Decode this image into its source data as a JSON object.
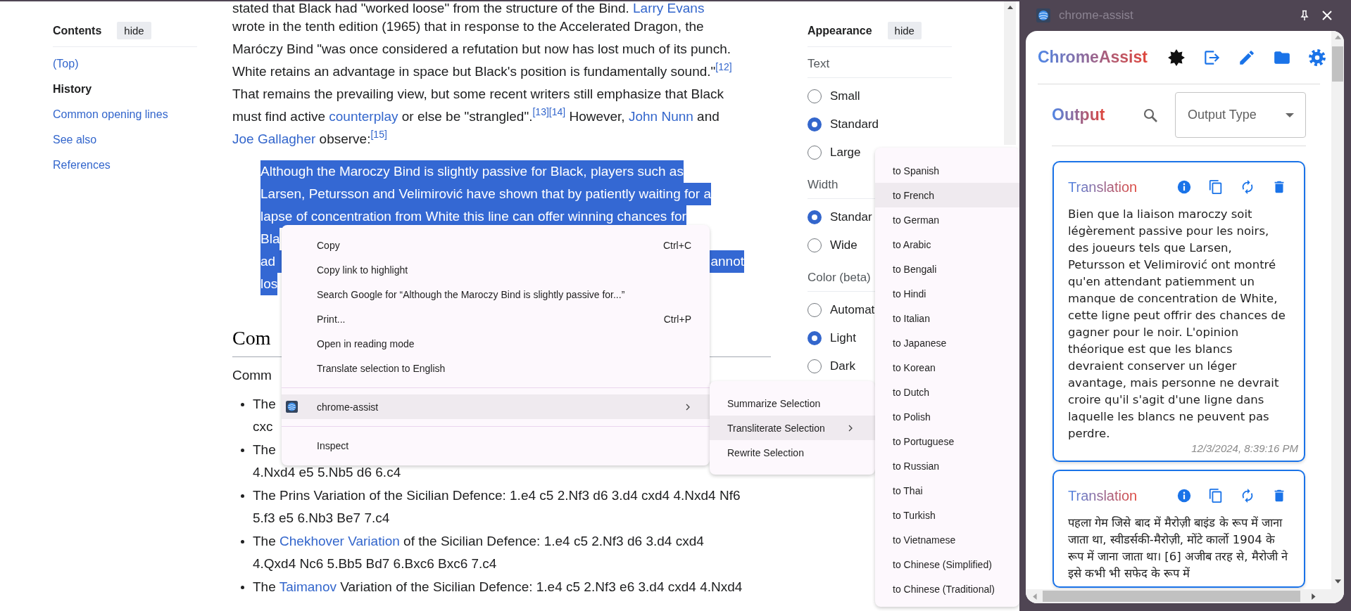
{
  "toc": {
    "title": "Contents",
    "hide_button": "hide",
    "items": [
      {
        "label": "(Top)",
        "selected": false
      },
      {
        "label": "History",
        "selected": true
      },
      {
        "label": "Common opening lines",
        "selected": false
      },
      {
        "label": "See also",
        "selected": false
      },
      {
        "label": "References",
        "selected": false
      }
    ]
  },
  "article": {
    "paragraph_lines": [
      [
        {
          "kind": "text",
          "text": "stated that Black had \"worked loose\" from the structure of the Bind.       "
        },
        {
          "kind": "link",
          "text": "Larry Evans"
        }
      ],
      [
        {
          "kind": "text",
          "text": "wrote in the tenth edition (1965) that in response to the Accelerated Dragon, the"
        }
      ],
      [
        {
          "kind": "text",
          "text": "Maróczy Bind \"was once considered a refutation but now has lost much of its punch."
        }
      ],
      [
        {
          "kind": "text",
          "text": "White retains an advantage in space but Black's position is fundamentally sound.\""
        },
        {
          "kind": "ref",
          "text": "[12]"
        }
      ],
      [
        {
          "kind": "text",
          "text": "That remains the prevailing view, but some recent writers still emphasize that Black"
        }
      ],
      [
        {
          "kind": "text",
          "text": "must find active "
        },
        {
          "kind": "link",
          "text": "counterplay"
        },
        {
          "kind": "text",
          "text": " or else be \"strangled\"."
        },
        {
          "kind": "ref",
          "text": "[13]"
        },
        {
          "kind": "ref",
          "text": "[14]"
        },
        {
          "kind": "text",
          "text": " However, "
        },
        {
          "kind": "link",
          "text": "John Nunn"
        },
        {
          "kind": "text",
          "text": " and"
        }
      ],
      [
        {
          "kind": "link",
          "text": "Joe Gallagher"
        },
        {
          "kind": "text",
          "text": " observe:"
        },
        {
          "kind": "ref",
          "text": "[15]"
        }
      ]
    ],
    "quote": {
      "selected": true,
      "lines": [
        [
          "Although the Maroczy Bind is slightly passive for Black, players such as"
        ],
        [
          "Larsen, Petursson and Velimirović have shown that by patiently waiting for a"
        ],
        [
          "lapse of concentration from White this line can offer winning chances for"
        ],
        [
          "Bla"
        ],
        [
          "ad",
          "annot"
        ],
        [
          "los"
        ]
      ]
    },
    "heading": "Com",
    "intro": "Comm",
    "list_items": [
      {
        "lines": [
          [
            {
              "kind": "text",
              "text": "The"
            }
          ],
          [
            {
              "kind": "text",
              "text": "cxc"
            }
          ]
        ]
      },
      {
        "lines": [
          [
            {
              "kind": "text",
              "text": "The"
            }
          ],
          [
            {
              "kind": "text",
              "text": "4.Nxd4 e5 5.Nb5 d6 6.c4"
            }
          ]
        ]
      },
      {
        "lines": [
          [
            {
              "kind": "text",
              "text": "The Prins Variation of the Sicilian Defence: 1.e4 c5 2.Nf3 d6 3.d4 cxd4 4.Nxd4 Nf6"
            }
          ],
          [
            {
              "kind": "text",
              "text": "5.f3 e5 6.Nb3 Be7 7.c4"
            }
          ]
        ]
      },
      {
        "lines": [
          [
            {
              "kind": "text",
              "text": "The "
            },
            {
              "kind": "link",
              "text": "Chekhover Variation"
            },
            {
              "kind": "text",
              "text": " of the Sicilian Defence: 1.e4 c5 2.Nf3 d6 3.d4 cxd4"
            }
          ],
          [
            {
              "kind": "text",
              "text": "4.Qxd4 Nc6 5.Bb5 Bd7 6.Bxc6 Bxc6 7.c4"
            }
          ]
        ]
      },
      {
        "lines": [
          [
            {
              "kind": "text",
              "text": "The "
            },
            {
              "kind": "link",
              "text": "Taimanov"
            },
            {
              "kind": "text",
              "text": " Variation of the Sicilian Defence: 1.e4 c5 2.Nf3 e6 3.d4 cxd4 4.Nxd4"
            }
          ]
        ]
      }
    ]
  },
  "appearance": {
    "title": "Appearance",
    "hide_button": "hide",
    "groups": [
      {
        "label": "Text",
        "options": [
          {
            "label": "Small",
            "selected": false
          },
          {
            "label": "Standard",
            "selected": true
          },
          {
            "label": "Large",
            "selected": false
          }
        ]
      },
      {
        "label": "Width",
        "options": [
          {
            "label": "Standar",
            "selected": true
          },
          {
            "label": "Wide",
            "selected": false
          }
        ]
      },
      {
        "label": "Color (beta)",
        "options": [
          {
            "label": "Automat",
            "selected": false
          },
          {
            "label": "Light",
            "selected": true
          },
          {
            "label": "Dark",
            "selected": false
          }
        ]
      }
    ]
  },
  "context_menu": {
    "items": [
      {
        "kind": "item",
        "label": "Copy",
        "shortcut": "Ctrl+C",
        "selected": false
      },
      {
        "kind": "item",
        "label": "Copy link to highlight",
        "selected": false
      },
      {
        "kind": "item",
        "label": "Search Google for “Although the Maroczy Bind is slightly passive for...”",
        "selected": false
      },
      {
        "kind": "item",
        "label": "Print...",
        "shortcut": "Ctrl+P",
        "selected": false
      },
      {
        "kind": "item",
        "label": "Open in reading mode",
        "selected": false
      },
      {
        "kind": "item",
        "label": "Translate selection to English",
        "selected": false
      },
      {
        "kind": "separator"
      },
      {
        "kind": "submenu",
        "label": "chrome-assist",
        "selected": true
      },
      {
        "kind": "separator"
      },
      {
        "kind": "item",
        "label": "Inspect",
        "selected": false
      }
    ]
  },
  "assist_menu": {
    "items": [
      {
        "label": "Summarize Selection",
        "selected": false,
        "submenu": false
      },
      {
        "label": "Transliterate Selection",
        "selected": true,
        "submenu": true
      },
      {
        "label": "Rewrite Selection",
        "selected": false,
        "submenu": false
      }
    ]
  },
  "language_menu": {
    "items": [
      {
        "label": "to Spanish",
        "selected": false
      },
      {
        "label": "to French",
        "selected": true
      },
      {
        "label": "to German",
        "selected": false
      },
      {
        "label": "to Arabic",
        "selected": false
      },
      {
        "label": "to Bengali",
        "selected": false
      },
      {
        "label": "to Hindi",
        "selected": false
      },
      {
        "label": "to Italian",
        "selected": false
      },
      {
        "label": "to Japanese",
        "selected": false
      },
      {
        "label": "to Korean",
        "selected": false
      },
      {
        "label": "to Dutch",
        "selected": false
      },
      {
        "label": "to Polish",
        "selected": false
      },
      {
        "label": "to Portuguese",
        "selected": false
      },
      {
        "label": "to Russian",
        "selected": false
      },
      {
        "label": "to Thai",
        "selected": false
      },
      {
        "label": "to Turkish",
        "selected": false
      },
      {
        "label": "to Vietnamese",
        "selected": false
      },
      {
        "label": "to Chinese (Simplified)",
        "selected": false
      },
      {
        "label": "to Chinese (Traditional)",
        "selected": false
      }
    ]
  },
  "assistant": {
    "window_title": "chrome-assist",
    "app_title": "ChromeAssist",
    "section_title": "Output",
    "filter": {
      "placeholder": "Output Type"
    },
    "cards": [
      {
        "title": "Translation",
        "text": "Bien que la liaison maroczy soit légèrement passive pour les noirs, des joueurs tels que Larsen, Petursson et Velimirović ont montré qu'en attendant patiemment un manque de concentration de White, cette ligne peut offrir des chances de gagner pour le noir. L'opinion théorique est que les blancs devraient conserver un léger avantage, mais personne ne devrait croire qu'il s'agit d'une ligne dans laquelle les blancs ne peuvent pas perdre.",
        "timestamp": "12/3/2024, 8:39:16 PM"
      },
      {
        "title": "Translation",
        "text": "पहला गेम जिसे बाद में मैरोज़ी बाइंड के रूप में जाना जाता था, स्वीडर्सकी-मैरोज़ी, मोंटे कार्लो 1904 के रूप में जाना जाता था। [6] अजीब तरह से, मैरोजी ने इसे कभी भी सफेद के रूप में"
      }
    ]
  }
}
